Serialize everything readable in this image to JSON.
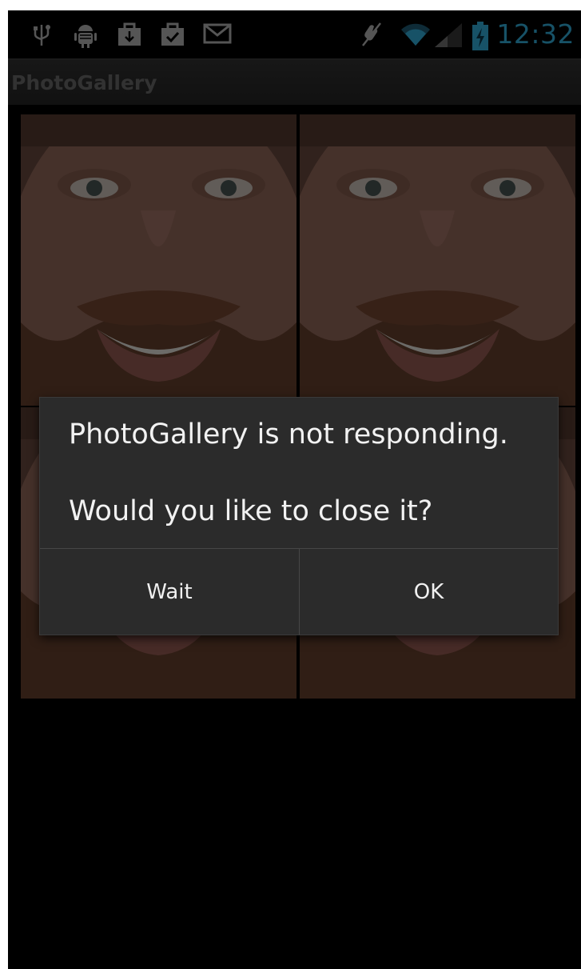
{
  "status_bar": {
    "time": "12:32",
    "icons": [
      "usb-icon",
      "android-debug-icon",
      "download-icon",
      "checkbox-icon",
      "gmail-icon",
      "mute-icon",
      "wifi-icon",
      "signal-icon",
      "battery-charging-icon"
    ],
    "accent_color": "#33b5e5"
  },
  "action_bar": {
    "title": "PhotoGallery"
  },
  "gallery": {
    "tiles": [
      "photo",
      "photo",
      "photo",
      "photo"
    ]
  },
  "dialog": {
    "message_line1": "PhotoGallery is not responding.",
    "message_line2": "Would you like to close it?",
    "wait_label": "Wait",
    "ok_label": "OK"
  }
}
